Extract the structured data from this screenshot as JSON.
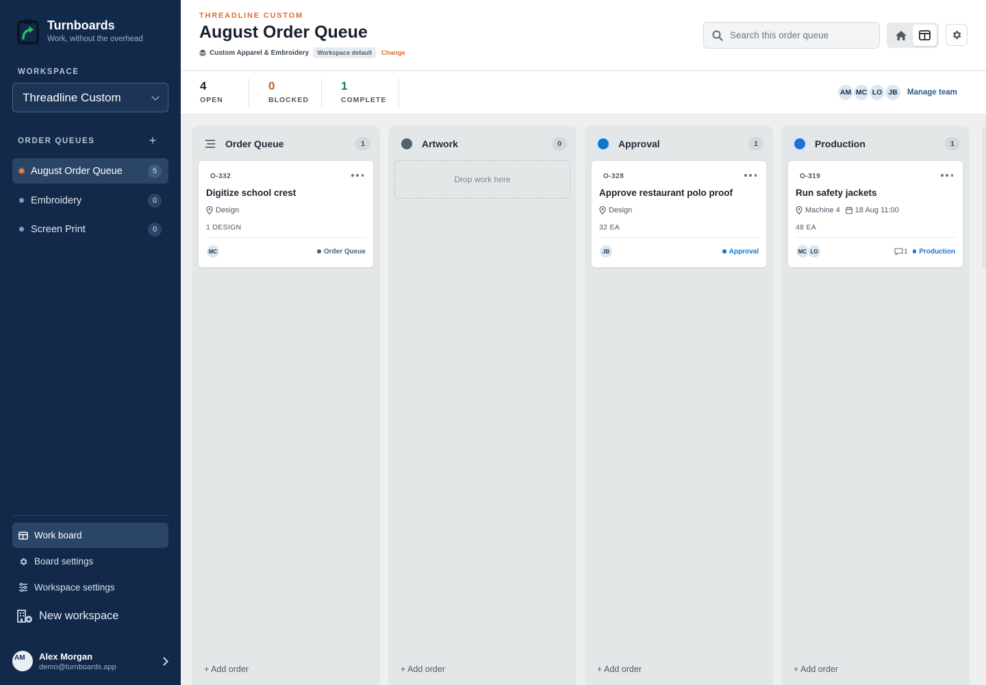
{
  "brand": {
    "name": "Turnboards",
    "tagline": "Work, without the overhead"
  },
  "sidebar": {
    "workspace_label": "WORKSPACE",
    "workspace_value": "Threadline Custom",
    "queues_label": "ORDER QUEUES",
    "queues": [
      {
        "label": "August Order Queue",
        "count": "5",
        "active": true
      },
      {
        "label": "Embroidery",
        "count": "0",
        "active": false
      },
      {
        "label": "Screen Print",
        "count": "0",
        "active": false
      }
    ],
    "nav": [
      {
        "label": "Work board",
        "icon": "board-icon",
        "active": true
      },
      {
        "label": "Board settings",
        "icon": "gear-icon",
        "active": false
      },
      {
        "label": "Workspace settings",
        "icon": "sliders-icon",
        "active": false
      }
    ],
    "new_workspace": "New workspace",
    "user": {
      "initials": "AM",
      "name": "Alex Morgan",
      "email": "demo@turnboards.app"
    }
  },
  "header": {
    "eyebrow": "THREADLINE CUSTOM",
    "title": "August Order Queue",
    "board_type": "Custom Apparel & Embroidery",
    "type_badge": "Workspace default",
    "change_label": "Change",
    "search_placeholder": "Search this order queue"
  },
  "stats": [
    {
      "value": "4",
      "label": "OPEN",
      "color": "#17202b"
    },
    {
      "value": "0",
      "label": "BLOCKED",
      "color": "#c2611f"
    },
    {
      "value": "1",
      "label": "COMPLETE",
      "color": "#1e7a5a"
    }
  ],
  "team": {
    "members": [
      "AM",
      "MC",
      "LO",
      "JB"
    ],
    "manage_label": "Manage team"
  },
  "colors": {
    "sidebar_bg": "#13294a",
    "accent": "#e06a2c",
    "order_queue": "#4a6276",
    "artwork": "#4e6272",
    "approval": "#1177c6",
    "production": "#1e6fd9"
  },
  "columns": [
    {
      "title": "Order Queue",
      "count": "1",
      "icon": "list-icon",
      "drop_text": "",
      "add_label": "+ Add order",
      "card": {
        "id": "O-332",
        "title": "Digitize school crest",
        "location": "Design",
        "due": "",
        "qty": "1 DESIGN",
        "assignees": [
          "MC"
        ],
        "comments": "",
        "status": "Order Queue"
      }
    },
    {
      "title": "Artwork",
      "count": "0",
      "icon": "circle-icon",
      "drop_text": "Drop work here",
      "add_label": "+ Add order",
      "card": null
    },
    {
      "title": "Approval",
      "count": "1",
      "icon": "circle-icon",
      "drop_text": "",
      "add_label": "+ Add order",
      "card": {
        "id": "O-328",
        "title": "Approve restaurant polo proof",
        "location": "Design",
        "due": "",
        "qty": "32 EA",
        "assignees": [
          "JB"
        ],
        "comments": "",
        "status": "Approval"
      }
    },
    {
      "title": "Production",
      "count": "1",
      "icon": "circle-icon",
      "drop_text": "",
      "add_label": "+ Add order",
      "card": {
        "id": "O-319",
        "title": "Run safety jackets",
        "location": "Machine 4",
        "due": "18 Aug 11:00",
        "qty": "48 EA",
        "assignees": [
          "MC",
          "LO"
        ],
        "comments": "1",
        "status": "Production"
      }
    }
  ]
}
